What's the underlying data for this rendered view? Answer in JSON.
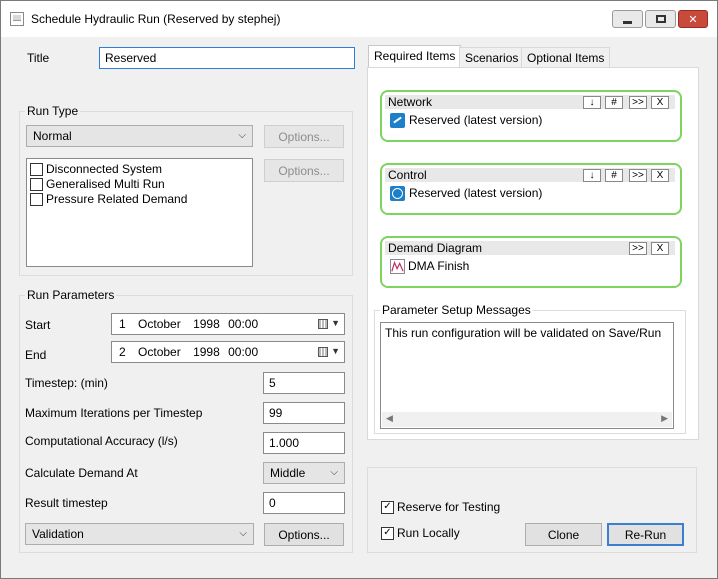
{
  "window": {
    "title": "Schedule Hydraulic Run (Reserved by stephej)",
    "buttons": {
      "minimize": "",
      "maximize": "",
      "close": "✕"
    }
  },
  "title_field": {
    "label": "Title",
    "value": "Reserved"
  },
  "run_type": {
    "group_label": "Run Type",
    "selected": "Normal",
    "options_button_1": "Options...",
    "options_button_2": "Options...",
    "checks": [
      {
        "label": "Disconnected System",
        "checked": false
      },
      {
        "label": "Generalised Multi Run",
        "checked": false
      },
      {
        "label": "Pressure Related Demand",
        "checked": false
      }
    ]
  },
  "run_parameters": {
    "group_label": "Run Parameters",
    "start": {
      "label": "Start",
      "day": "1",
      "month": "October",
      "year": "1998",
      "time": "00:00"
    },
    "end": {
      "label": "End",
      "day": "2",
      "month": "October",
      "year": "1998",
      "time": "00:00"
    },
    "timestep": {
      "label": "Timestep: (min)",
      "value": "5"
    },
    "max_iterations": {
      "label": "Maximum Iterations per Timestep",
      "value": "99"
    },
    "accuracy": {
      "label": "Computational Accuracy (l/s)",
      "value": "1.000"
    },
    "demand_at": {
      "label": "Calculate Demand At",
      "value": "Middle"
    },
    "result_timestep": {
      "label": "Result timestep",
      "value": "0"
    },
    "validation": {
      "value": "Validation",
      "options_button": "Options..."
    }
  },
  "tabs": [
    {
      "label": "Required Items",
      "active": true
    },
    {
      "label": "Scenarios",
      "active": false
    },
    {
      "label": "Optional Items",
      "active": false
    }
  ],
  "required_items": [
    {
      "title": "Network",
      "value": "Reserved (latest version)",
      "icon": "network-icon",
      "buttons": [
        "↓",
        "#",
        ">>",
        "X"
      ]
    },
    {
      "title": "Control",
      "value": "Reserved (latest version)",
      "icon": "control-icon",
      "buttons": [
        "↓",
        "#",
        ">>",
        "X"
      ]
    },
    {
      "title": "Demand Diagram",
      "value": "DMA Finish",
      "icon": "demand-diagram-icon",
      "buttons": [
        ">>",
        "X"
      ]
    }
  ],
  "parameter_messages": {
    "label": "Parameter Setup Messages",
    "text": "This run configuration will be validated on Save/Run"
  },
  "bottom": {
    "reserve_for_testing": {
      "label": "Reserve for Testing",
      "checked": true
    },
    "run_locally": {
      "label": "Run Locally",
      "checked": true
    },
    "clone_button": "Clone",
    "rerun_button": "Re-Run"
  },
  "colors": {
    "item_border": "#7fd35f",
    "accent": "#3c7fd1",
    "close": "#c84a3a"
  }
}
